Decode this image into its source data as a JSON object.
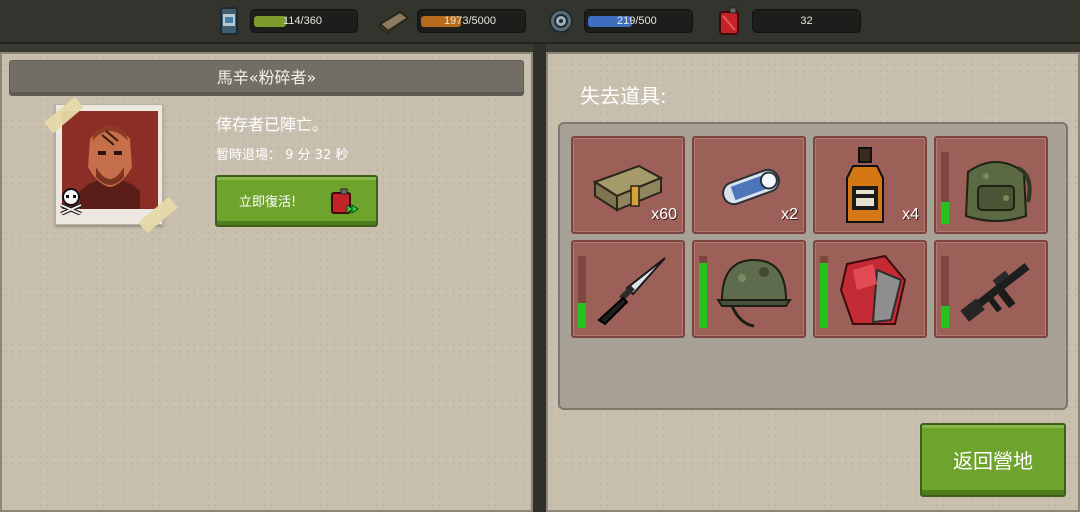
{
  "resources": [
    {
      "icon": "water-can-icon",
      "value": "114/360",
      "current": 114,
      "max": 360,
      "fill_color": "#7e9a2a"
    },
    {
      "icon": "wood-plank-icon",
      "value": "1973/5000",
      "current": 1973,
      "max": 5000,
      "fill_color": "#b56a1c"
    },
    {
      "icon": "gear-icon",
      "value": "219/500",
      "current": 219,
      "max": 500,
      "fill_color": "#3e6ec0"
    },
    {
      "icon": "fuel-canister-icon",
      "value": "32"
    }
  ],
  "survivor": {
    "name": "馬辛«粉碎者»",
    "status": "倖存者已陣亡。",
    "timer": "暫時退場： 9 分 32 秒",
    "revive_label": "立即復活!"
  },
  "lost_items": {
    "title": "失去道具:",
    "items": [
      {
        "name": "ammo-box",
        "icon": "ammo-box-icon",
        "quantity": "x60"
      },
      {
        "name": "bandage",
        "icon": "bandage-roll-icon",
        "quantity": "x2"
      },
      {
        "name": "whiskey-bottle",
        "icon": "whiskey-bottle-icon",
        "quantity": "x4"
      },
      {
        "name": "backpack",
        "icon": "backpack-icon",
        "durability": 0.3
      },
      {
        "name": "combat-knife",
        "icon": "knife-icon",
        "durability": 0.35
      },
      {
        "name": "helmet",
        "icon": "helmet-icon",
        "durability": 0.9
      },
      {
        "name": "armor-vest",
        "icon": "armor-vest-icon",
        "durability": 0.9
      },
      {
        "name": "assault-rifle",
        "icon": "rifle-icon",
        "durability": 0.3
      }
    ]
  },
  "return_button": "返回營地",
  "colors": {
    "accent_green": "#6ea32d",
    "slot_red": "#9c6058",
    "durability_green": "#25c31b"
  }
}
